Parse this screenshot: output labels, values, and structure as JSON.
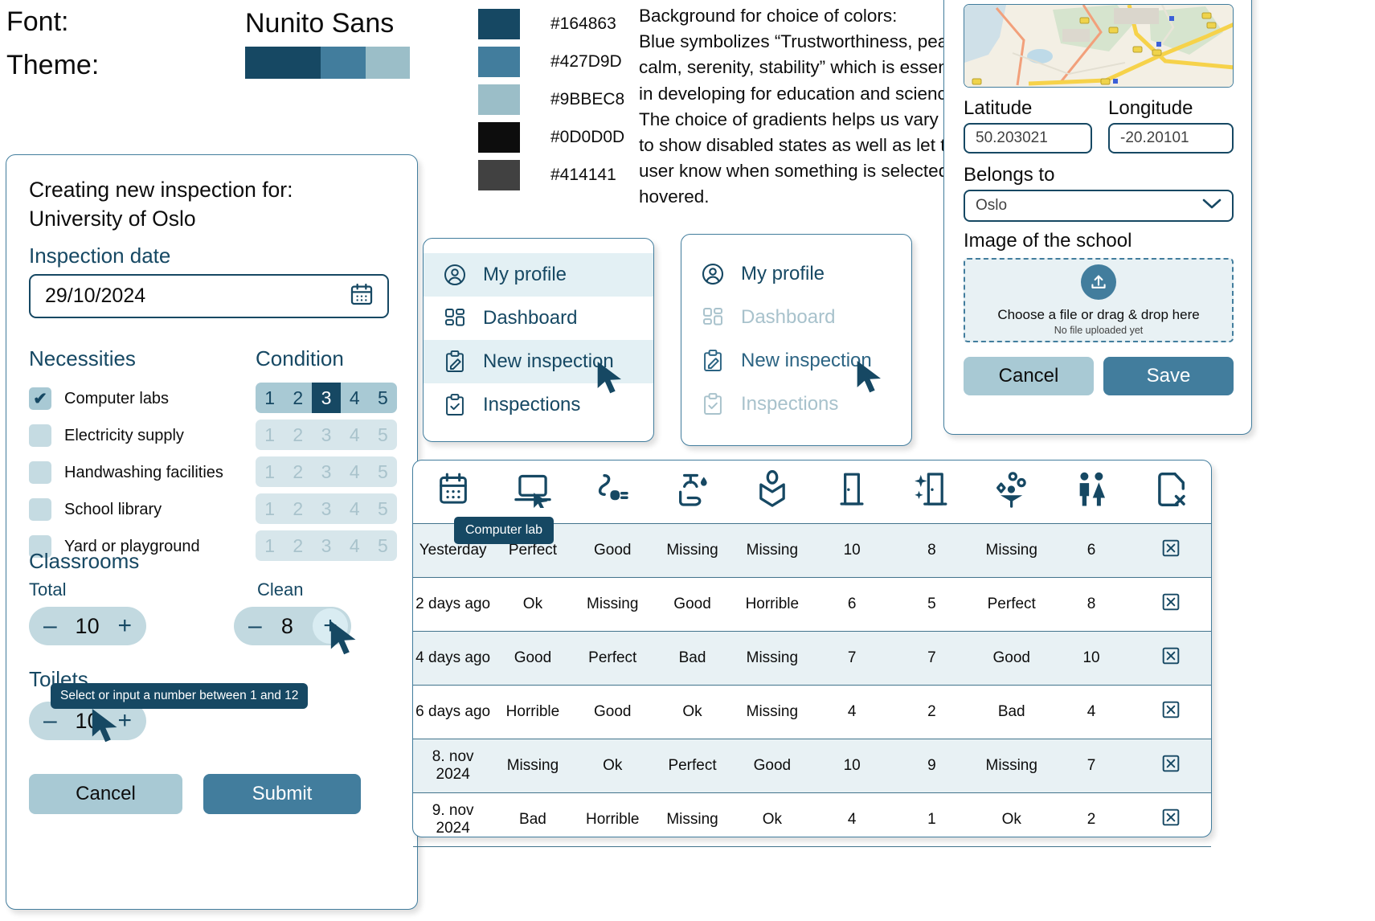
{
  "header": {
    "font_label": "Font:",
    "theme_label": "Theme:",
    "font_value": "Nunito Sans",
    "theme_colors": [
      "#164863",
      "#427D9D",
      "#9BBEC8"
    ]
  },
  "palette": {
    "swatches": [
      {
        "hex": "#164863",
        "label": "#164863"
      },
      {
        "hex": "#427D9D",
        "label": "#427D9D"
      },
      {
        "hex": "#9BBEC8",
        "label": "#9BBEC8"
      },
      {
        "hex": "#0D0D0D",
        "label": "#0D0D0D"
      },
      {
        "hex": "#414141",
        "label": "#414141"
      }
    ]
  },
  "description": {
    "lines": [
      "Background for choice of colors:",
      "Blue symbolizes “Trustworthiness, peace,",
      "calm, serenity, stability” which is essential",
      "in developing for education and science.",
      "The choice of gradients helps us vary and",
      "to show disabled states as well as let the",
      "user know when something is selected or",
      "hovered."
    ]
  },
  "inspection_form": {
    "title_line1": "Creating new inspection for:",
    "title_line2": "University of Oslo",
    "date_label": "Inspection date",
    "date_value": "29/10/2024",
    "date_icon": "calendar-icon",
    "necessities_label": "Necessities",
    "condition_label": "Condition",
    "rows": [
      {
        "name": "Computer labs",
        "checked": true,
        "active": true,
        "selected": 3
      },
      {
        "name": "Electricity supply",
        "checked": false,
        "active": false,
        "selected": 0
      },
      {
        "name": "Handwashing facilities",
        "checked": false,
        "active": false,
        "selected": 0
      },
      {
        "name": "School library",
        "checked": false,
        "active": false,
        "selected": 0
      },
      {
        "name": "Yard or playground",
        "checked": false,
        "active": false,
        "selected": 0
      }
    ],
    "condition_values": [
      "1",
      "2",
      "3",
      "4",
      "5"
    ],
    "classrooms_label": "Classrooms",
    "total_label": "Total",
    "total_value": "10",
    "clean_label": "Clean",
    "clean_value": "8",
    "toilets_label": "Toilets",
    "toilets_value": "10",
    "toilets_tooltip": "Select or input a number between 1 and 12",
    "minus_sign": "–",
    "plus_sign": "+",
    "cancel_label": "Cancel",
    "submit_label": "Submit"
  },
  "nav_menu_hover": {
    "items": [
      {
        "label": "My profile",
        "icon": "user-circle-icon",
        "state": "highlighted"
      },
      {
        "label": "Dashboard",
        "icon": "dashboard-grid-icon",
        "state": "normal"
      },
      {
        "label": "New inspection",
        "icon": "clipboard-pencil-icon",
        "state": "hovered"
      },
      {
        "label": "Inspections",
        "icon": "clipboard-check-icon",
        "state": "normal"
      }
    ]
  },
  "nav_menu_disabled": {
    "items": [
      {
        "label": "My profile",
        "icon": "user-circle-icon",
        "state": "normal"
      },
      {
        "label": "Dashboard",
        "icon": "dashboard-grid-icon",
        "state": "disabled"
      },
      {
        "label": "New inspection",
        "icon": "clipboard-pencil-icon",
        "state": "active"
      },
      {
        "label": "Inspections",
        "icon": "clipboard-check-icon",
        "state": "disabled"
      }
    ]
  },
  "school_form": {
    "map_icon": "map-preview",
    "latitude_label": "Latitude",
    "latitude_value": "50.203021",
    "longitude_label": "Longitude",
    "longitude_value": "-20.20101",
    "belongs_label": "Belongs to",
    "belongs_value": "Oslo",
    "belongs_caret": "chevron-down-icon",
    "image_label": "Image of the school",
    "upload_icon": "upload-icon",
    "dropzone_main": "Choose a file or drag & drop here",
    "dropzone_sub": "No file uploaded yet",
    "cancel_label": "Cancel",
    "save_label": "Save"
  },
  "inspections_table": {
    "tooltip": "Computer lab",
    "columns": [
      {
        "icon": "calendar-icon",
        "name": "date"
      },
      {
        "icon": "laptop-icon",
        "name": "computer-lab"
      },
      {
        "icon": "plug-icon",
        "name": "electricity"
      },
      {
        "icon": "handwashing-icon",
        "name": "handwashing"
      },
      {
        "icon": "book-icon",
        "name": "library"
      },
      {
        "icon": "door-icon",
        "name": "classrooms-total"
      },
      {
        "icon": "sparkle-door-icon",
        "name": "classrooms-clean"
      },
      {
        "icon": "playground-icon",
        "name": "yard"
      },
      {
        "icon": "restroom-icon",
        "name": "toilets"
      },
      {
        "icon": "file-x-icon",
        "name": "delete"
      }
    ],
    "rows": [
      {
        "cells": [
          "Yesterday",
          "Perfect",
          "Good",
          "Missing",
          "Missing",
          "10",
          "8",
          "Missing",
          "6"
        ],
        "delete_icon": "delete-box-icon",
        "alt": true
      },
      {
        "cells": [
          "2 days ago",
          "Ok",
          "Missing",
          "Good",
          "Horrible",
          "6",
          "5",
          "Perfect",
          "8"
        ],
        "delete_icon": "delete-box-icon",
        "alt": false
      },
      {
        "cells": [
          "4 days ago",
          "Good",
          "Perfect",
          "Bad",
          "Missing",
          "7",
          "7",
          "Good",
          "10"
        ],
        "delete_icon": "delete-box-icon",
        "alt": true
      },
      {
        "cells": [
          "6 days ago",
          "Horrible",
          "Good",
          "Ok",
          "Missing",
          "4",
          "2",
          "Bad",
          "4"
        ],
        "delete_icon": "delete-box-icon",
        "alt": false
      },
      {
        "cells": [
          "8. nov 2024",
          "Missing",
          "Ok",
          "Perfect",
          "Good",
          "10",
          "9",
          "Missing",
          "7"
        ],
        "delete_icon": "delete-box-icon",
        "alt": true
      },
      {
        "cells": [
          "9. nov 2024",
          "Bad",
          "Horrible",
          "Missing",
          "Ok",
          "4",
          "1",
          "Ok",
          "2"
        ],
        "delete_icon": "delete-box-icon",
        "alt": false
      }
    ]
  }
}
